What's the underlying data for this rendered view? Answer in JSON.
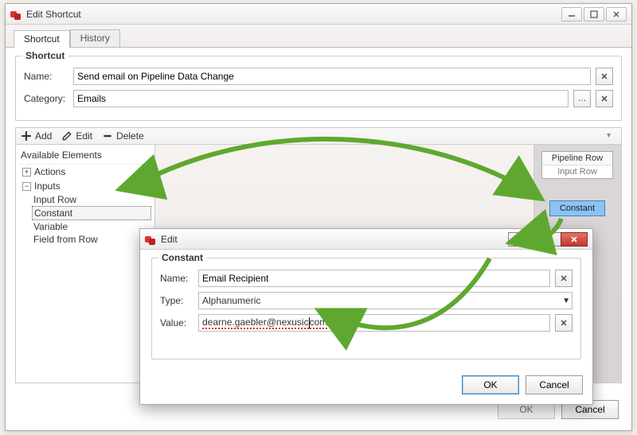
{
  "mainWindow": {
    "title": "Edit Shortcut",
    "tabs": {
      "shortcut": "Shortcut",
      "history": "History"
    },
    "group": {
      "legend": "Shortcut",
      "nameLabel": "Name:",
      "nameValue": "Send email on Pipeline Data Change",
      "categoryLabel": "Category:",
      "categoryValue": "Emails"
    },
    "toolbar": {
      "add": "Add",
      "edit": "Edit",
      "delete": "Delete"
    },
    "tree": {
      "header": "Available Elements",
      "actions": "Actions",
      "inputs": "Inputs",
      "leaves": {
        "inputRow": "Input Row",
        "constant": "Constant",
        "variable": "Variable",
        "fieldFromRow": "Field from Row"
      }
    },
    "canvas": {
      "pipelineRow": {
        "title": "Pipeline Row",
        "sub": "Input Row"
      },
      "constant": "Constant"
    },
    "buttons": {
      "ok": "OK",
      "cancel": "Cancel"
    }
  },
  "editDialog": {
    "title": "Edit",
    "group": {
      "legend": "Constant",
      "nameLabel": "Name:",
      "nameValue": "Email Recipient",
      "typeLabel": "Type:",
      "typeValue": "Alphanumeric",
      "valueLabel": "Value:",
      "valuePrefix": "dearne.gaebler@nexusic",
      "valueSuffix": "com"
    },
    "buttons": {
      "ok": "OK",
      "cancel": "Cancel"
    }
  }
}
